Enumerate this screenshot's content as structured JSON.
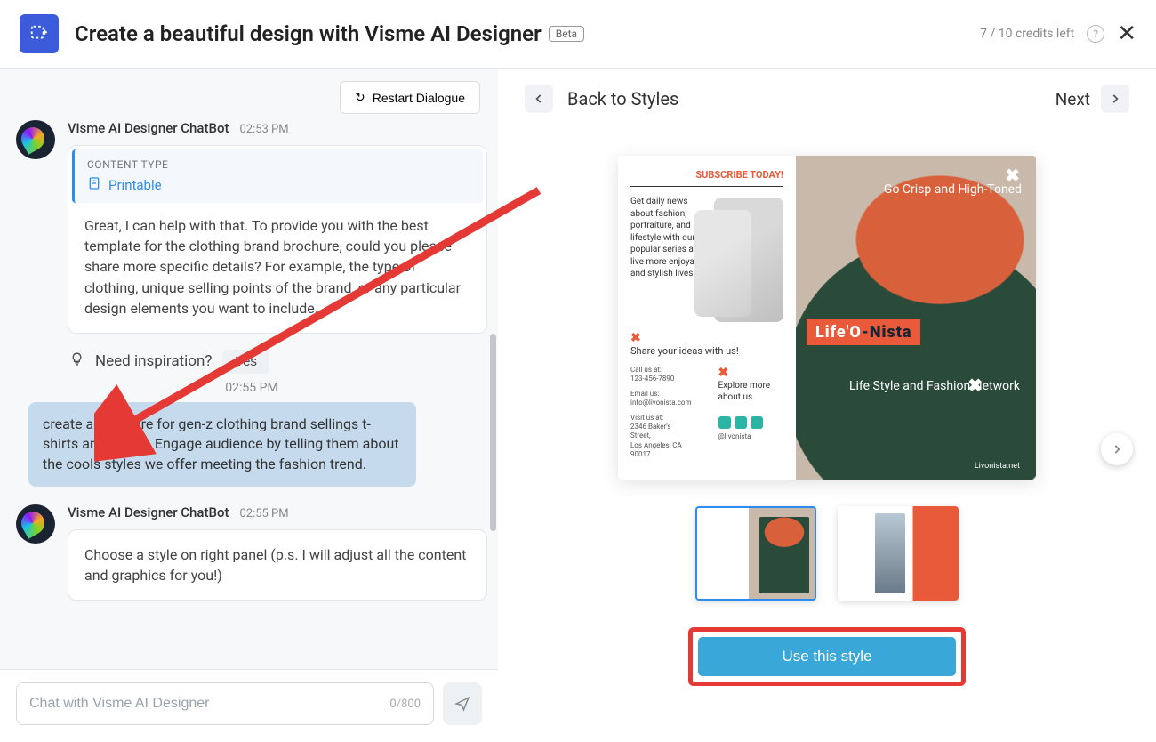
{
  "header": {
    "title": "Create a beautiful design with Visme AI Designer",
    "badge": "Beta",
    "credits": "7 / 10 credits left"
  },
  "chat": {
    "restart": "Restart Dialogue",
    "bot_name": "Visme AI Designer ChatBot",
    "msg1_time": "02:53 PM",
    "content_type_label": "CONTENT TYPE",
    "content_type_value": "Printable",
    "msg1_text": "Great, I can help with that. To provide you with the best template for the clothing brand brochure, could you please share more specific details? For example, the type of clothing, unique selling points of the brand, or any particular design elements you want to include.",
    "inspire_label": "Need inspiration?",
    "inspire_yes": "Yes",
    "user_time": "02:55 PM",
    "user_msg": "create a brochure for gen-z clothing brand sellings t-shirts and shoes. Engage audience by telling them about the cools styles we offer meeting the fashion trend.",
    "msg2_time": "02:55 PM",
    "msg2_text": "Choose a style on right panel (p.s. I will adjust all the content and graphics for you!)",
    "input_placeholder": "Chat with Visme AI Designer",
    "char_count": "0/800"
  },
  "right": {
    "back": "Back to Styles",
    "next": "Next",
    "use_style": "Use this style",
    "preview": {
      "subscribe": "SUBSCRIBE TODAY!",
      "newsblurb": "Get daily news about fashion, portraiture, and lifestyle with our popular series and live more enjoyable and stylish lives.",
      "share": "Share your ideas with us!",
      "callus": "Call us at:",
      "phone": "123-456-7890",
      "emailus": "Email us:",
      "email": "info@livonista.com",
      "visitus": "Visit us at:",
      "addr1": "2346 Baker's Street,",
      "addr2": "Los Angeles, CA 90017",
      "explore": "Explore more about us",
      "handle": "@livonista",
      "crisp": "Go Crisp and High-Toned",
      "brand1": "Life'O",
      "brand2": "-Nista",
      "lifestyle": "Life Style and Fashion Network",
      "domain": "Livonista.net"
    }
  }
}
